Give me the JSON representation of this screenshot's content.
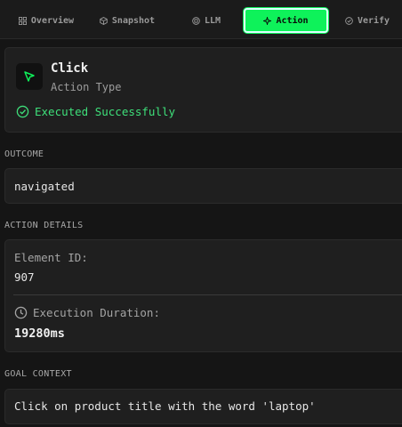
{
  "tabs": [
    {
      "label": "Overview",
      "icon": "grid-icon",
      "active": false
    },
    {
      "label": "Snapshot",
      "icon": "cube-icon",
      "active": false
    },
    {
      "label": "LLM",
      "icon": "chip-icon",
      "active": false
    },
    {
      "label": "Action",
      "icon": "sparkle-icon",
      "active": true
    },
    {
      "label": "Verify",
      "icon": "check-circle-icon",
      "active": false
    }
  ],
  "action": {
    "name": "Click",
    "type_label": "Action Type",
    "icon": "cursor-pointer-icon",
    "status": "Executed Successfully"
  },
  "outcome": {
    "title": "OUTCOME",
    "value": "navigated"
  },
  "details": {
    "title": "ACTION DETAILS",
    "element_id_label": "Element ID:",
    "element_id_value": "907",
    "duration_label": "Execution Duration:",
    "duration_value": "19280ms"
  },
  "goal": {
    "title": "GOAL CONTEXT",
    "value": "Click on product title with the word 'laptop'"
  },
  "colors": {
    "accent": "#0ef25a",
    "success": "#3ee07a",
    "background": "#151515",
    "card": "#1f1f1f"
  }
}
